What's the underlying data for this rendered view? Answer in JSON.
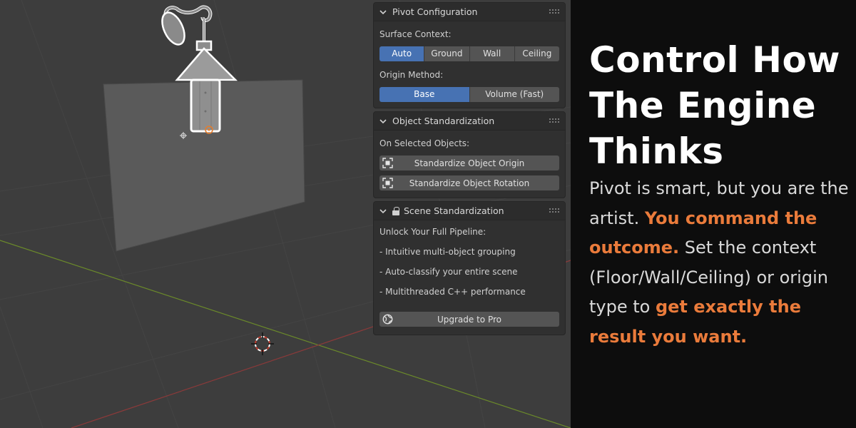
{
  "colors": {
    "viewport_bg": "#3d3d3d",
    "panel_bg": "#303030",
    "active_button": "#4772b3",
    "button_bg": "#545454",
    "promo_bg": "#0d0d0d",
    "accent": "#ea7b3b",
    "grid_x_axis": "#8b3a3a",
    "grid_y_axis": "#6b8a2a"
  },
  "panels": {
    "pivot": {
      "title": "Pivot Configuration",
      "surface_label": "Surface Context:",
      "surface_options": [
        "Auto",
        "Ground",
        "Wall",
        "Ceiling"
      ],
      "surface_selected": "Auto",
      "origin_label": "Origin Method:",
      "origin_options": [
        "Base",
        "Volume (Fast)"
      ],
      "origin_selected": "Base"
    },
    "standardization": {
      "title": "Object Standardization",
      "subtitle": "On Selected Objects:",
      "origin_button": "Standardize Object Origin",
      "rotation_button": "Standardize Object Rotation"
    },
    "scene": {
      "title": "Scene Standardization",
      "subtitle": "Unlock Your Full Pipeline:",
      "features": [
        "- Intuitive multi-object grouping",
        "- Auto-classify your entire scene",
        "- Multithreaded C++ performance"
      ],
      "upgrade_button": "Upgrade to Pro"
    }
  },
  "promo": {
    "headline_lines": [
      "Control How",
      "The Engine",
      "Thinks"
    ],
    "body_1": "Pivot is smart, but you are the artist. ",
    "accent_1": "You command the outcome.",
    "body_2": " Set the context (Floor/Wall/Ceiling) or origin type to ",
    "accent_2": "get exactly the result you want."
  },
  "icons": {
    "chevron": "chevron-down-icon",
    "grip": "drag-grip-icon",
    "lock": "lock-icon",
    "origin": "origin-frame-icon",
    "rotation": "rotation-frame-icon",
    "globe": "globe-icon",
    "cursor3d": "3d-cursor-icon"
  }
}
